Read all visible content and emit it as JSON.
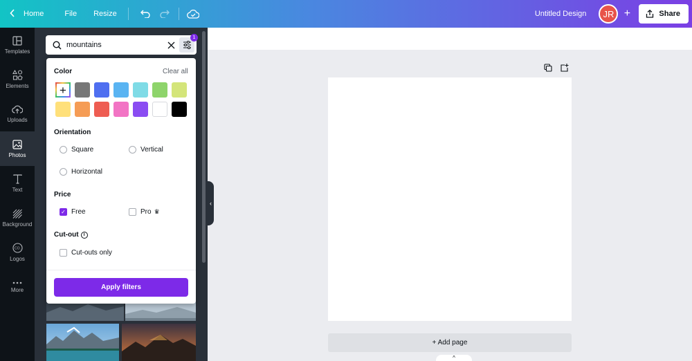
{
  "topbar": {
    "home_label": "Home",
    "file_label": "File",
    "resize_label": "Resize",
    "design_title": "Untitled Design",
    "avatar_initials": "JR",
    "add_member": "+",
    "share_label": "Share"
  },
  "rail": {
    "items": [
      {
        "label": "Templates",
        "icon": "templates-icon"
      },
      {
        "label": "Elements",
        "icon": "elements-icon"
      },
      {
        "label": "Uploads",
        "icon": "upload-icon"
      },
      {
        "label": "Photos",
        "icon": "photo-icon",
        "active": true
      },
      {
        "label": "Text",
        "icon": "text-icon"
      },
      {
        "label": "Background",
        "icon": "background-icon"
      },
      {
        "label": "Logos",
        "icon": "logo-icon"
      },
      {
        "label": "More",
        "icon": "more-icon"
      }
    ]
  },
  "search": {
    "value": "mountains",
    "filter_count": "1"
  },
  "filters": {
    "color": {
      "heading": "Color",
      "clear_label": "Clear all",
      "add_symbol": "+",
      "swatches": [
        "#777777",
        "#4f6ff0",
        "#5ab4f2",
        "#7fdbe6",
        "#8ed46b",
        "#d4e57a",
        "#ffe07a",
        "#f59c55",
        "#ee5d52",
        "#f274c4",
        "#8a4cf2",
        "#ffffff",
        "#000000"
      ]
    },
    "orientation": {
      "heading": "Orientation",
      "options": [
        "Square",
        "Vertical",
        "Horizontal"
      ]
    },
    "price": {
      "heading": "Price",
      "free_label": "Free",
      "free_checked": true,
      "pro_label": "Pro",
      "pro_checked": false
    },
    "cutout": {
      "heading": "Cut-out",
      "info_symbol": "i",
      "option_label": "Cut-outs only",
      "checked": false
    },
    "apply_label": "Apply filters"
  },
  "canvas": {
    "add_page_label": "+ Add page",
    "notes_symbol": "^"
  },
  "colors": {
    "accent": "#7d2ae8",
    "gradient_start": "#12c4c5",
    "gradient_end": "#7b3fe4",
    "sidebar": "#0e1318",
    "panel": "#293039"
  }
}
